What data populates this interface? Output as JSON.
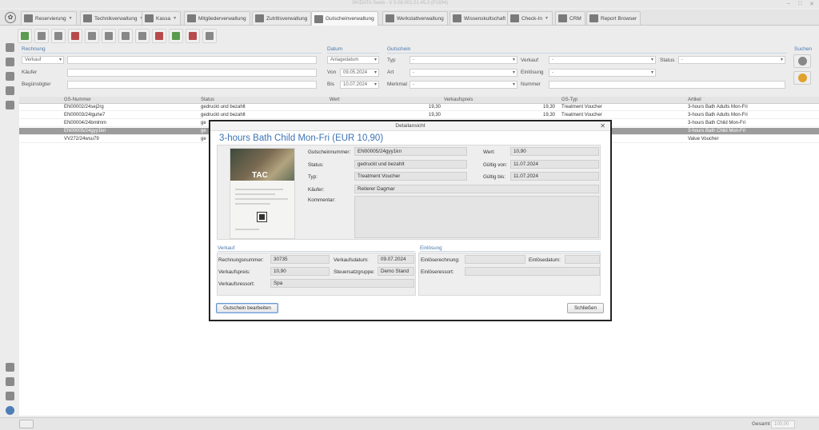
{
  "window": {
    "title": "SKIDATA Sweb - V 5.08.001.01.45.3 (P1694)"
  },
  "tabs": [
    {
      "label": "Reservierung",
      "dropdown": true
    },
    {
      "label": "Technikverwaltung",
      "dropdown": true
    },
    {
      "label": "Kassa",
      "dropdown": true
    },
    {
      "label": "Mitgliederverwaltung",
      "dropdown": false
    },
    {
      "label": "Zutrittsverwaltung",
      "dropdown": false
    },
    {
      "label": "Gutscheinverwaltung",
      "dropdown": false
    },
    {
      "label": "Werkstattverwaltung",
      "dropdown": false
    },
    {
      "label": "Wissenskultschaft",
      "dropdown": false
    },
    {
      "label": "Check-In",
      "dropdown": true
    },
    {
      "label": "CRM",
      "dropdown": false
    },
    {
      "label": "Report Browser",
      "dropdown": false
    }
  ],
  "filters": {
    "rechnung": {
      "title": "Rechnung",
      "verkauf_select": "Verkauf",
      "kaeufer_label": "Käufer",
      "beguenstigter_label": "Begünstigter"
    },
    "datum": {
      "title": "Datum",
      "anlagedatum_select": "Anlagedatum",
      "von_label": "Von",
      "von_value": "09.05.2024",
      "bis_label": "Bis",
      "bis_value": "10.07.2024"
    },
    "gutschein": {
      "title": "Gutschein",
      "typ_label": "Typ",
      "typ_value": "-",
      "art_label": "Art",
      "art_value": "-",
      "merkmal_label": "Merkmal",
      "merkmal_value": "-",
      "verkauf_label": "Verkauf",
      "verkauf_value": "-",
      "einloesung_label": "Einlösung",
      "einloesung_value": "-",
      "nummer_label": "Nummer",
      "status_label": "Status",
      "status_value": "-"
    },
    "suchen": {
      "title": "Suchen"
    }
  },
  "list": {
    "columns": [
      "GS-Nummer",
      "Status",
      "Wert",
      "Verkaufspreis",
      "GS-Typ",
      "Artikel"
    ],
    "rows": [
      {
        "nummer": "EN00002/24sej2rg",
        "status": "gedruckt und bezahlt",
        "wert": "",
        "preis": "19,30",
        "typwert": "19,30",
        "typ": "Treatment Voucher",
        "artikel": "3-hours Bath Adults Mon-Fri"
      },
      {
        "nummer": "EN00003/24lguhe7",
        "status": "gedruckt und bezahlt",
        "wert": "",
        "preis": "19,30",
        "typwert": "19,30",
        "typ": "Treatment Voucher",
        "artikel": "3-hours Bath Adults Mon-Fri"
      },
      {
        "nummer": "EN00004/24bmlmm",
        "status": "ge",
        "wert": "",
        "preis": "",
        "typwert": "",
        "typ": "",
        "artikel": "3-hours Bath Child Mon-Fri"
      },
      {
        "nummer": "EN00005/24gyy1kn",
        "status": "ge",
        "wert": "",
        "preis": "",
        "typwert": "",
        "typ": "",
        "artikel": "3-hours Bath Child Mon-Fri"
      },
      {
        "nummer": "VV272/24wsu79",
        "status": "ge",
        "wert": "",
        "preis": "",
        "typwert": "",
        "typ": "",
        "artikel": "Value Voucher"
      }
    ]
  },
  "status_bar": {
    "gesamt_label": "Gesamt",
    "gesamt_value": "100,00"
  },
  "dialog": {
    "title": "Detailansicht",
    "heading": "3-hours Bath Child Mon-Fri (EUR 10,90)",
    "thumb_logo": "TAC",
    "fields": {
      "gutscheinnummer_label": "Gutscheinnummer:",
      "gutscheinnummer": "EN00005/24gyy1kn",
      "status_label": "Status:",
      "status": "gedruckt und bezahlt",
      "typ_label": "Typ:",
      "typ": "Treatment Voucher",
      "kaeufer_label": "Käufer:",
      "kaeufer": "Reiterer Dagmar",
      "kommentar_label": "Kommentar:",
      "kommentar": "",
      "wert_label": "Wert:",
      "wert": "10,90",
      "gueltig_von_label": "Gültig von:",
      "gueltig_von": "11.07.2024",
      "gueltig_bis_label": "Gültig bis:",
      "gueltig_bis": "11.07.2024"
    },
    "verkauf": {
      "title": "Verkauf",
      "rechnungsnummer_label": "Rechnungsnummer:",
      "rechnungsnummer": "30735",
      "verkaufsdatum_label": "Verkaufsdatum:",
      "verkaufsdatum": "09.07.2024",
      "verkaufspreis_label": "Verkaufspreis:",
      "verkaufspreis": "10,90",
      "steuersatzgruppe_label": "Steuersatzgruppe:",
      "steuersatzgruppe": "Demo Stand",
      "verkaufsressort_label": "Verkaufsressort:",
      "verkaufsressort": "Spa"
    },
    "einloesung": {
      "title": "Einlösung",
      "einloeserechnung_label": "Einlöserechnung:",
      "einloeserechnung": "",
      "einloesedatum_label": "Einlösedatum:",
      "einloesedatum": "",
      "einloeseressort_label": "Einlöseressort:",
      "einloeseressort": ""
    },
    "buttons": {
      "edit": "Gutschein bearbeiten",
      "close": "Schließen"
    }
  }
}
